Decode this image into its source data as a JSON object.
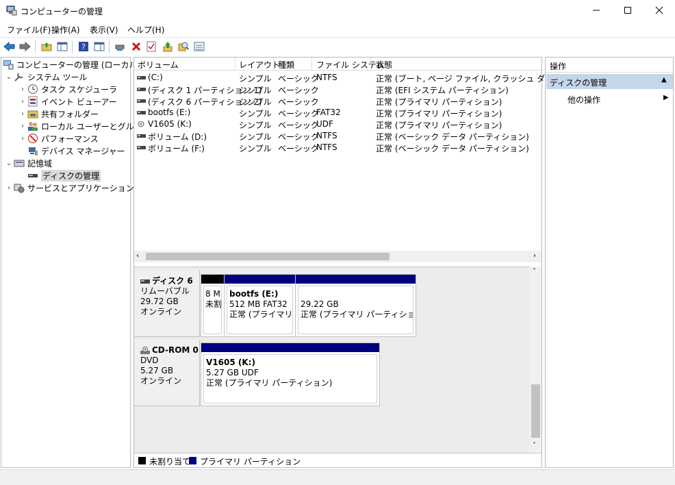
{
  "window": {
    "title": "コンピューターの管理",
    "minimize_icon": "minimize-icon",
    "maximize_icon": "maximize-icon",
    "close_icon": "close-icon"
  },
  "menu": [
    "ファイル(F)",
    "操作(A)",
    "表示(V)",
    "ヘルプ(H)"
  ],
  "tree": {
    "root": "コンピューターの管理 (ローカル)",
    "system_tools": "システム ツール",
    "task_scheduler": "タスク スケジューラ",
    "event_viewer": "イベント ビューアー",
    "shared_folders": "共有フォルダー",
    "local_users": "ローカル ユーザーとグループ",
    "performance": "パフォーマンス",
    "device_manager": "デバイス マネージャー",
    "storage": "記憶域",
    "disk_management": "ディスクの管理",
    "services_apps": "サービスとアプリケーション"
  },
  "volumes": {
    "headers": [
      "ボリューム",
      "レイアウト",
      "種類",
      "ファイル システム",
      "状態"
    ],
    "rows": [
      [
        "(C:)",
        "シンプル",
        "ベーシック",
        "NTFS",
        "正常 (ブート, ページ ファイル, クラッシュ ダンプ, ベーシ"
      ],
      [
        "(ディスク 1 パーティション 1)",
        "シンプル",
        "ベーシック",
        "",
        "正常 (EFI システム パーティション)"
      ],
      [
        "(ディスク 6 パーティション 2)",
        "シンプル",
        "ベーシック",
        "",
        "正常 (プライマリ パーティション)"
      ],
      [
        "bootfs (E:)",
        "シンプル",
        "ベーシック",
        "FAT32",
        "正常 (プライマリ パーティション)"
      ],
      [
        "V1605 (K:)",
        "シンプル",
        "ベーシック",
        "UDF",
        "正常 (プライマリ パーティション)"
      ],
      [
        "ボリューム (D:)",
        "シンプル",
        "ベーシック",
        "NTFS",
        "正常 (ベーシック データ パーティション)"
      ],
      [
        "ボリューム (F:)",
        "シンプル",
        "ベーシック",
        "NTFS",
        "正常 (ベーシック データ パーティション)"
      ]
    ]
  },
  "disks": {
    "disk6": {
      "name": "ディスク 6",
      "type": "リムーバブル",
      "size": "29.72 GB",
      "status": "オンライン",
      "unalloc_size": "8 M",
      "unalloc_label": "未割",
      "p1_name": "bootfs  (E:)",
      "p1_size": "512 MB FAT32",
      "p1_status": "正常 (プライマリ パ",
      "p2_size": "29.22 GB",
      "p2_status": "正常 (プライマリ パーティション)"
    },
    "cdrom": {
      "name": "CD-ROM 0",
      "type": "DVD",
      "size": "5.27 GB",
      "status": "オンライン",
      "p_name": "V1605  (K:)",
      "p_size": "5.27 GB UDF",
      "p_status": "正常 (プライマリ パーティション)"
    }
  },
  "legend": {
    "unallocated": "未割り当て",
    "primary": "プライマリ パーティション"
  },
  "actions": {
    "title": "操作",
    "section": "ディスクの管理",
    "more": "他の操作"
  },
  "colors": {
    "primary_partition": "#00007f",
    "unallocated": "#000000",
    "selection": "#c5d5ea"
  }
}
